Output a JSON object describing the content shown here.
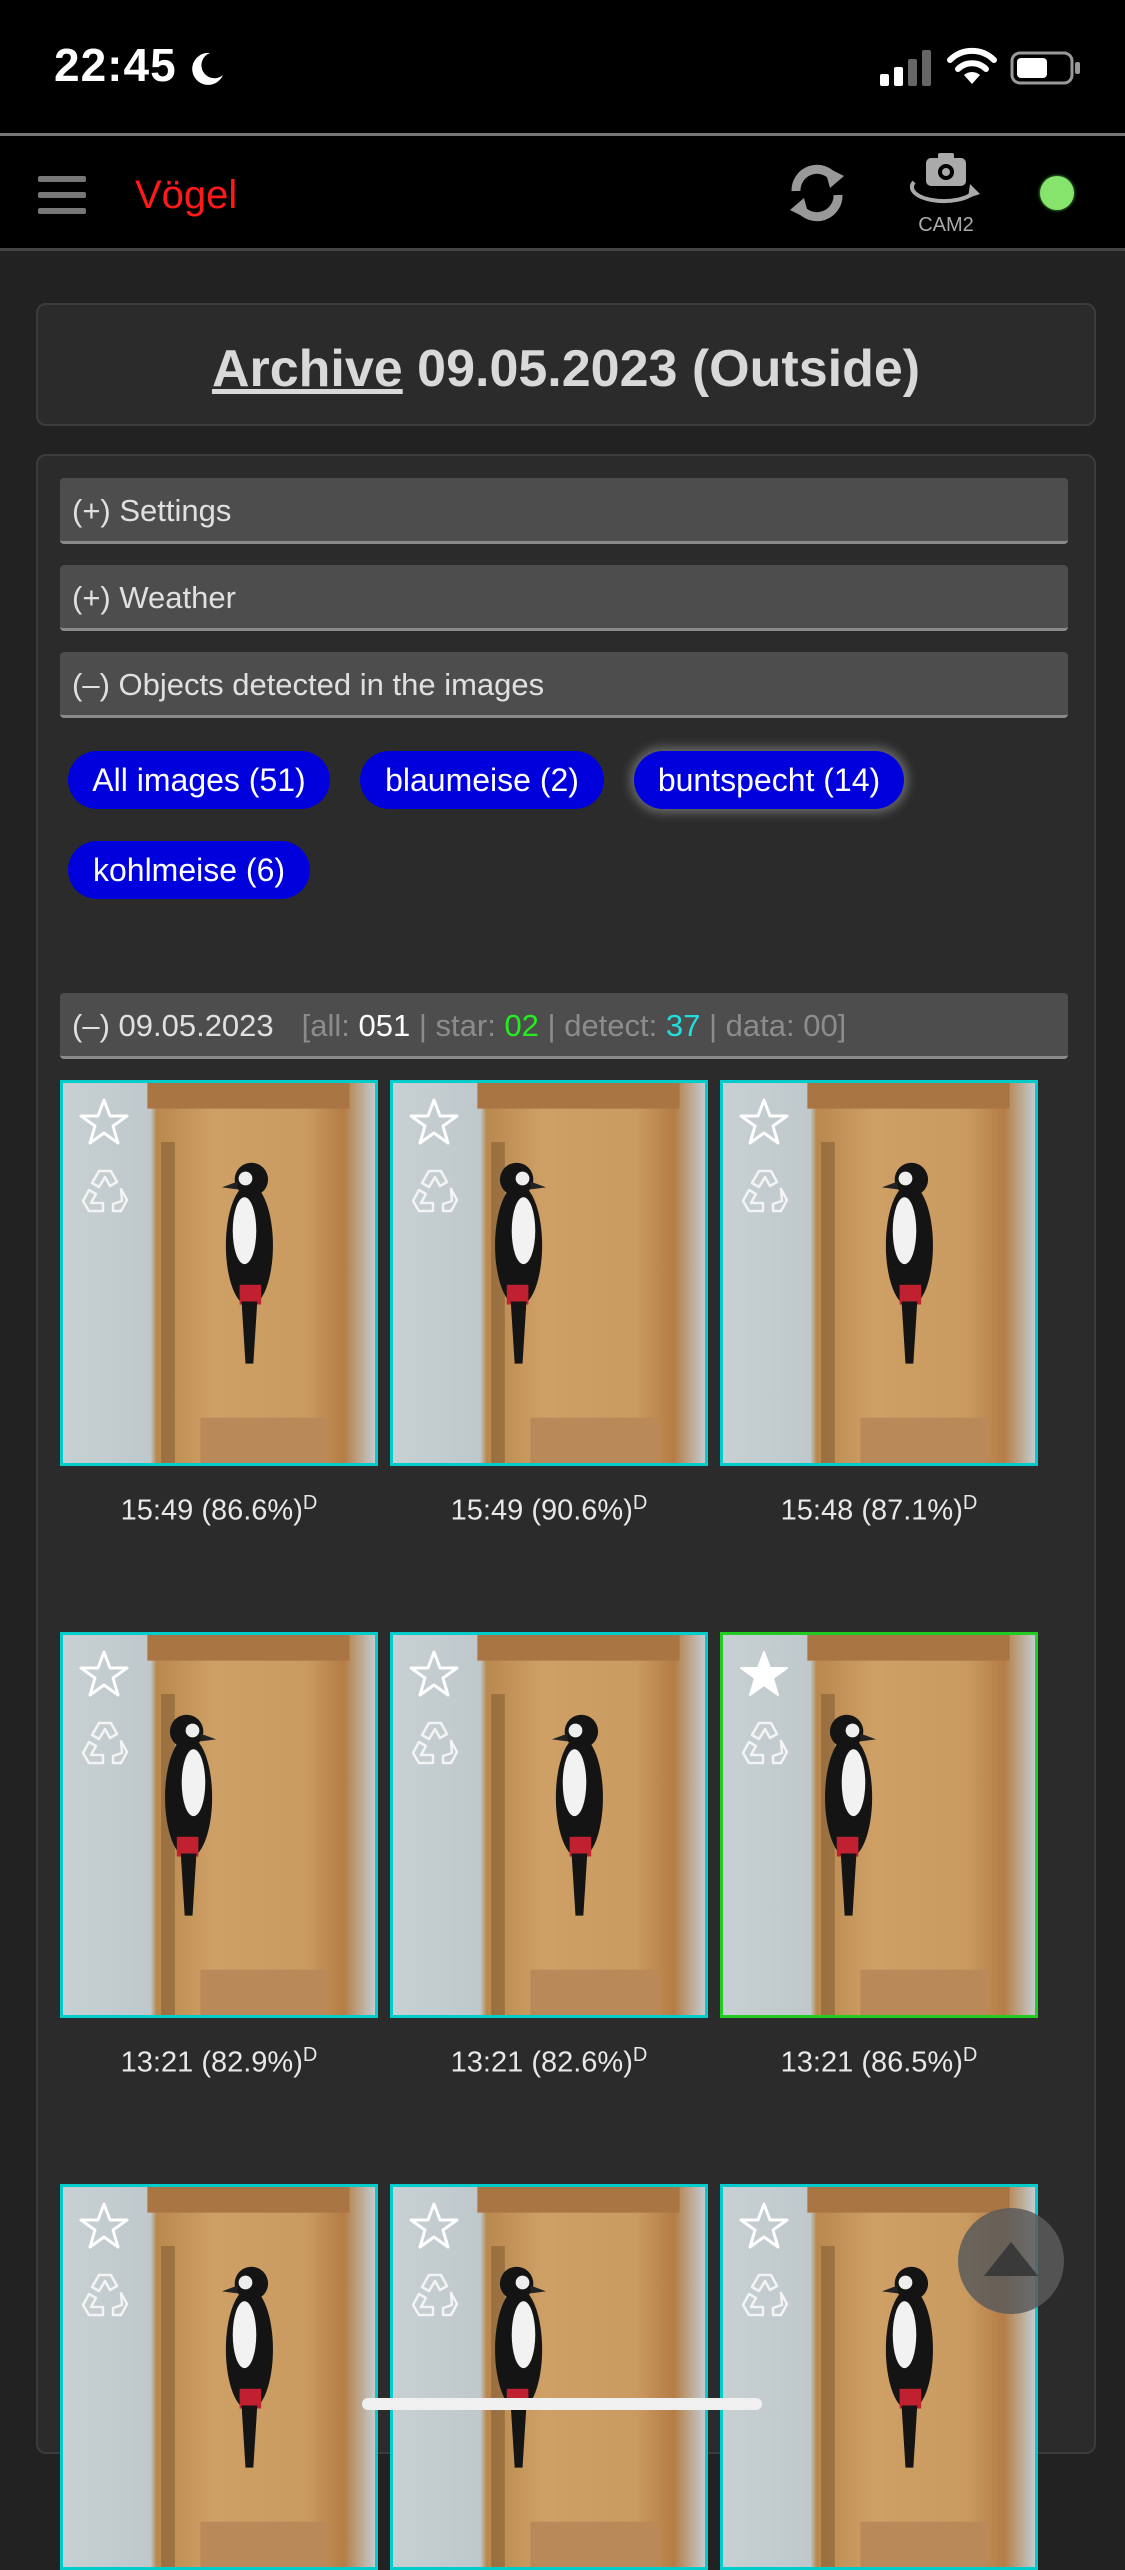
{
  "status_bar": {
    "time": "22:45"
  },
  "nav": {
    "title": "Vögel",
    "cam_label": "CAM2",
    "connection_status_color": "#86e36b"
  },
  "page": {
    "title_link": "Archive",
    "title_rest": " 09.05.2023 (Outside)"
  },
  "sections": [
    {
      "label": "(+) Settings"
    },
    {
      "label": "(+) Weather"
    },
    {
      "label": "(–) Objects detected in the images"
    }
  ],
  "filters": [
    {
      "label": "All images (51)",
      "active": false
    },
    {
      "label": "blaumeise (2)",
      "active": false
    },
    {
      "label": "buntspecht (14)",
      "active": true
    },
    {
      "label": "kohlmeise (6)",
      "active": false
    }
  ],
  "day_group": {
    "label": "(–) 09.05.2023",
    "stats_all_label": "[all: ",
    "stats_all": "051",
    "stats_star_label": " | star: ",
    "stats_star": "02",
    "stats_detect_label": " | detect: ",
    "stats_detect": "37",
    "stats_data_label": " | data: 00]"
  },
  "images": [
    {
      "time": "15:49",
      "confidence": "(86.6%)",
      "mark": "D",
      "starred": false
    },
    {
      "time": "15:49",
      "confidence": "(90.6%)",
      "mark": "D",
      "starred": false
    },
    {
      "time": "15:48",
      "confidence": "(87.1%)",
      "mark": "D",
      "starred": false
    },
    {
      "time": "13:21",
      "confidence": "(82.9%)",
      "mark": "D",
      "starred": false
    },
    {
      "time": "13:21",
      "confidence": "(82.6%)",
      "mark": "D",
      "starred": false
    },
    {
      "time": "13:21",
      "confidence": "(86.5%)",
      "mark": "D",
      "starred": true
    },
    {
      "starred": false
    },
    {
      "starred": false
    },
    {
      "starred": false
    }
  ],
  "colors": {
    "accent_title": "#ff1a1a",
    "pill": "#0000dd",
    "border_detected": "#00cccc",
    "border_starred": "#22cc22"
  }
}
